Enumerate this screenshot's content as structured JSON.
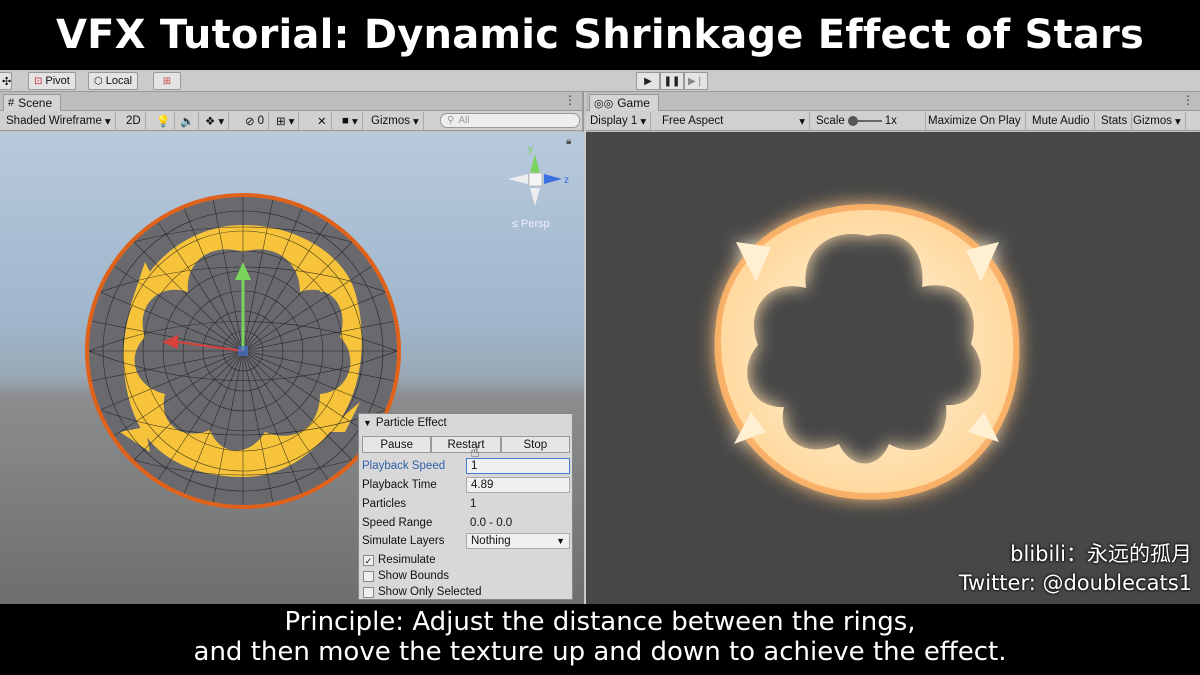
{
  "title": "VFX Tutorial: Dynamic Shrinkage Effect of Stars",
  "toolbar": {
    "pivot_label": "Pivot",
    "local_label": "Local"
  },
  "scene": {
    "tab_label": "Scene",
    "shading_mode": "Shaded Wireframe",
    "mode_2d": "2D",
    "hidden_count": "0",
    "gizmos_label": "Gizmos",
    "search_placeholder": "All",
    "persp_label": "Persp",
    "gizmo_axis_y": "y",
    "gizmo_axis_z": "z"
  },
  "game": {
    "tab_label": "Game",
    "display": "Display 1",
    "aspect": "Free Aspect",
    "scale_label": "Scale",
    "scale_value": "1x",
    "maximize_label": "Maximize On Play",
    "mute_label": "Mute Audio",
    "stats_label": "Stats",
    "gizmos_label": "Gizmos"
  },
  "particle_effect": {
    "header": "Particle Effect",
    "pause": "Pause",
    "restart": "Restart",
    "stop": "Stop",
    "rows": [
      {
        "label": "Playback Speed",
        "value": "1"
      },
      {
        "label": "Playback Time",
        "value": "4.89"
      },
      {
        "label": "Particles",
        "value": "1"
      },
      {
        "label": "Speed Range",
        "value": "0.0 - 0.0"
      },
      {
        "label": "Simulate Layers",
        "value": "Nothing"
      }
    ],
    "checks": [
      {
        "label": "Resimulate",
        "checked": true
      },
      {
        "label": "Show Bounds",
        "checked": false
      },
      {
        "label": "Show Only Selected",
        "checked": false
      }
    ]
  },
  "credit": {
    "line1": "blibili：永远的孤月",
    "line2": "Twitter: @doublecats1"
  },
  "subtitle": {
    "line1": "Principle: Adjust the distance between the rings,",
    "line2": "and then move the texture up and down to achieve the effect."
  },
  "colors": {
    "accent_blue": "#2f5fa8",
    "ring_yellow": "#f6c33a",
    "sphere_orange": "#e0621a",
    "glow": "#ffb466"
  },
  "icons": [
    "pivot-icon",
    "local-icon",
    "play-icon",
    "pause-icon",
    "step-icon",
    "light-icon",
    "audio-icon",
    "effects-icon",
    "hidden-icon",
    "grid-icon",
    "tool-icon",
    "camera-icon",
    "search-icon",
    "game-controller-icon",
    "persp-icon",
    "lock-icon"
  ]
}
